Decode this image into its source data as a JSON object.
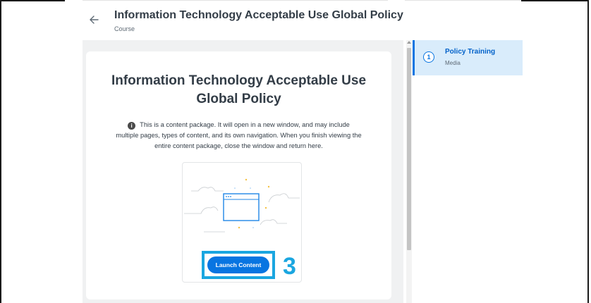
{
  "header": {
    "title": "Information Technology Acceptable Use Global Policy",
    "subtitle": "Course",
    "back_icon": "arrow-left-icon"
  },
  "content_card": {
    "title_lines": [
      "Information Technology Acceptable Use",
      "Global Policy"
    ],
    "info_icon": "info-icon",
    "info_lines": [
      "This is a content package. It will open in a new window, and may include",
      "multiple pages, types of content, and its own navigation. When you finish viewing the",
      "entire content package, close the window and return here."
    ],
    "launch_button_label": "Launch Content",
    "annotation_number": "3"
  },
  "sidebar": {
    "items": [
      {
        "step": "1",
        "title": "Policy Training",
        "subtitle": "Media"
      }
    ]
  },
  "colors": {
    "accent": "#0875e1",
    "annotation": "#1aa6e0",
    "selected_bg": "#d9ecfb",
    "main_bg": "#f0f1f2"
  }
}
